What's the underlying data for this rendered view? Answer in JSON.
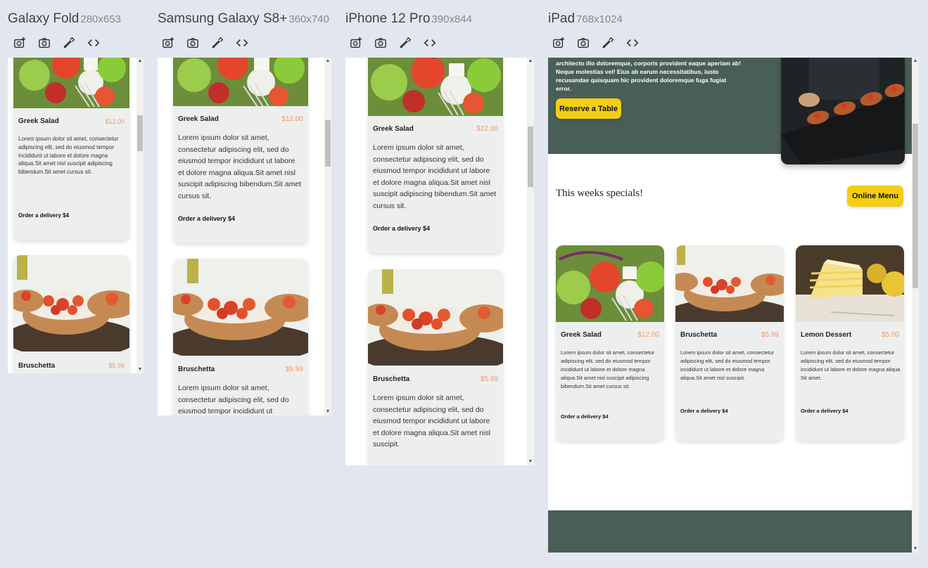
{
  "devices": {
    "fold": {
      "name": "Galaxy Fold",
      "size": "280x653"
    },
    "s8": {
      "name": "Samsung Galaxy S8+",
      "size": "360x740"
    },
    "iphone": {
      "name": "iPhone 12 Pro",
      "size": "390x844"
    },
    "ipad": {
      "name": "iPad",
      "size": "768x1024"
    }
  },
  "menu": {
    "greek": {
      "title": "Greek Salad",
      "price": "$12.00"
    },
    "bruschetta": {
      "title": "Bruschetta",
      "price": "$5.99"
    },
    "lemon": {
      "title": "Lemon Dessert",
      "price": "$5.00"
    }
  },
  "descs": {
    "greek": "Lorem ipsum dolor sit amet, consectetur adipiscing elit, sed do eiusmod tempor incididunt ut labore et dolore magna aliqua.Sit amet nisl suscipit adipiscing bibendum.Sit amet cursus sit.",
    "bruschetta_full": "Lorem ipsum dolor sit amet, consectetur adipiscing elit, sed do eiusmod tempor incididunt ut labore et dolore magna aliqua.Sit amet nisl suscipit.",
    "bruschetta_s8": "Lorem ipsum dolor sit amet, consectetur adipiscing elit, sed do eiusmod tempor incididunt ut",
    "lemon": "Lorem ipsum dolor sit amet, consectetur adipiscing elit, sed do eiusmod tempor incididunt ut labore et dolore magna aliqua Sit amet."
  },
  "order_label": "Order a delivery $4",
  "ipad": {
    "hero_text": "architecto illo doloremque, corporis provident eaque aperiam ab! Neque molestias vel! Eius ab earum necessitatibus, iusto recusandae quisquam hic provident doloremque fuga fugiat error.",
    "reserve": "Reserve a Table",
    "specials": "This weeks specials!",
    "online_menu": "Online Menu"
  },
  "colors": {
    "primary": "#495e57",
    "yellow": "#f4ce14",
    "price": "#ee9972",
    "card": "#edefee"
  },
  "icons": [
    "screenshot-icon",
    "camera-icon",
    "color-picker-icon",
    "code-icon"
  ]
}
